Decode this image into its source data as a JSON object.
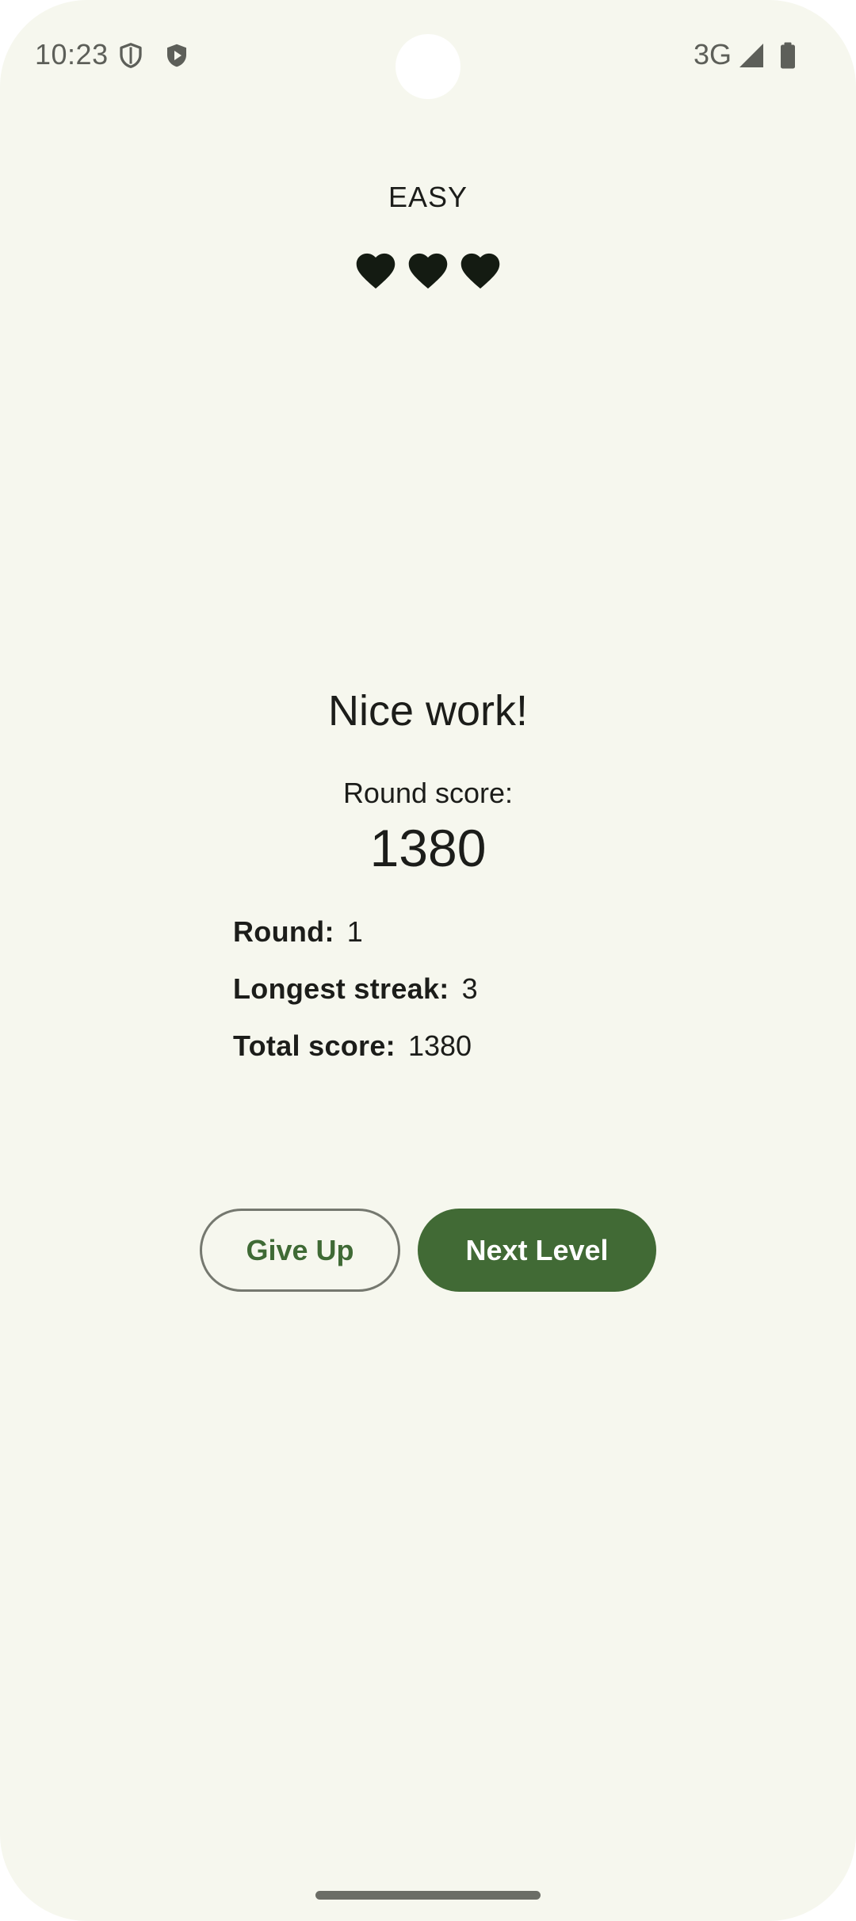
{
  "status_bar": {
    "time": "10:23",
    "network": "3G",
    "icons": [
      "shield-icon",
      "play-protect-icon",
      "signal-icon",
      "battery-icon"
    ]
  },
  "game": {
    "difficulty": "EASY",
    "lives": 3,
    "lives_icon": "heart-icon"
  },
  "result": {
    "title": "Nice work!",
    "round_score_label": "Round score:",
    "round_score_value": "1380",
    "stats": [
      {
        "label": "Round:",
        "value": "1"
      },
      {
        "label": "Longest streak:",
        "value": "3"
      },
      {
        "label": "Total score:",
        "value": "1380"
      }
    ]
  },
  "buttons": {
    "give_up": "Give Up",
    "next_level": "Next Level"
  },
  "colors": {
    "background": "#f6f7ee",
    "primary": "#416a35",
    "outline": "#75786f",
    "text": "#1c1d1a"
  }
}
